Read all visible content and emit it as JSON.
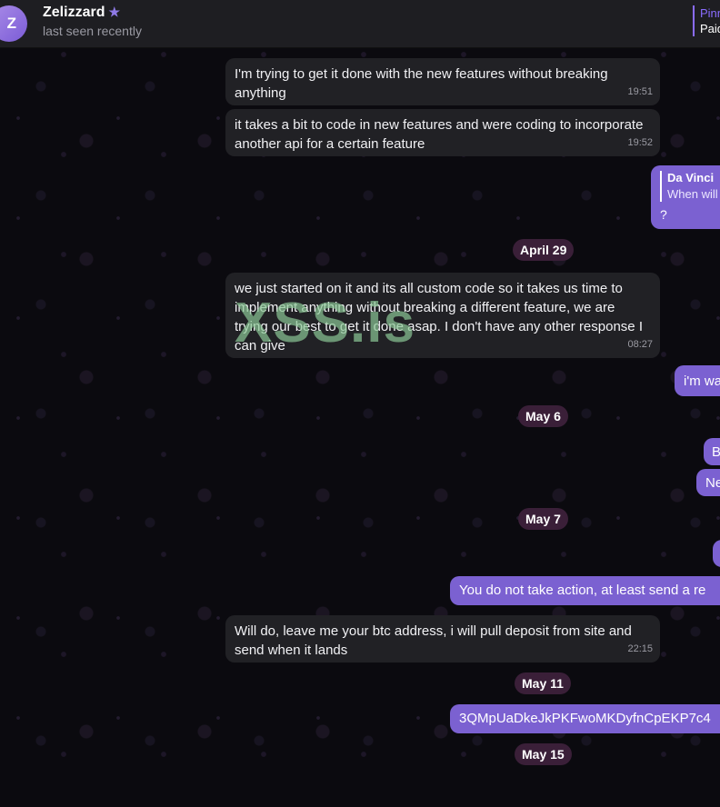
{
  "header": {
    "avatar_letter": "Z",
    "name": "Zelizzard",
    "status": "last seen recently",
    "pinned_label": "Pinn",
    "pinned_text": "Paid"
  },
  "messages_in": [
    {
      "text": "I'm trying to get it done with the new features without breaking anything",
      "time": "19:51"
    },
    {
      "text": "it takes a bit to code in new features and were coding to incorporate another api for a certain feature",
      "time": "19:52"
    },
    {
      "text": "we just started on it and its all custom code so it takes us time to implement anything without breaking a different feature, we are trying our best to get it done asap. I don't have any other response I can give",
      "time": "08:27"
    },
    {
      "text": "Will do, leave me your btc address, i will pull deposit from site and send when it lands",
      "time": "22:15"
    }
  ],
  "dates": [
    "April 29",
    "May 6",
    "May 7",
    "May 11",
    "May 15"
  ],
  "reply": {
    "name": "Da Vinci",
    "text": "When will",
    "body": "?"
  },
  "messages_out": [
    {
      "text": "i'm wa"
    },
    {
      "text": "B"
    },
    {
      "text": "Ne"
    },
    {
      "text": "You do not take action, at least send a re"
    },
    {
      "text": "3QMpUaDkeJkPKFwoMKDyfnCpEKP7c4"
    }
  ],
  "watermark": "XSS.is",
  "colors": {
    "outgoing": "#7b61d1",
    "incoming": "#212125",
    "date_badge": "#3a1f38",
    "header": "#1e1e22"
  }
}
